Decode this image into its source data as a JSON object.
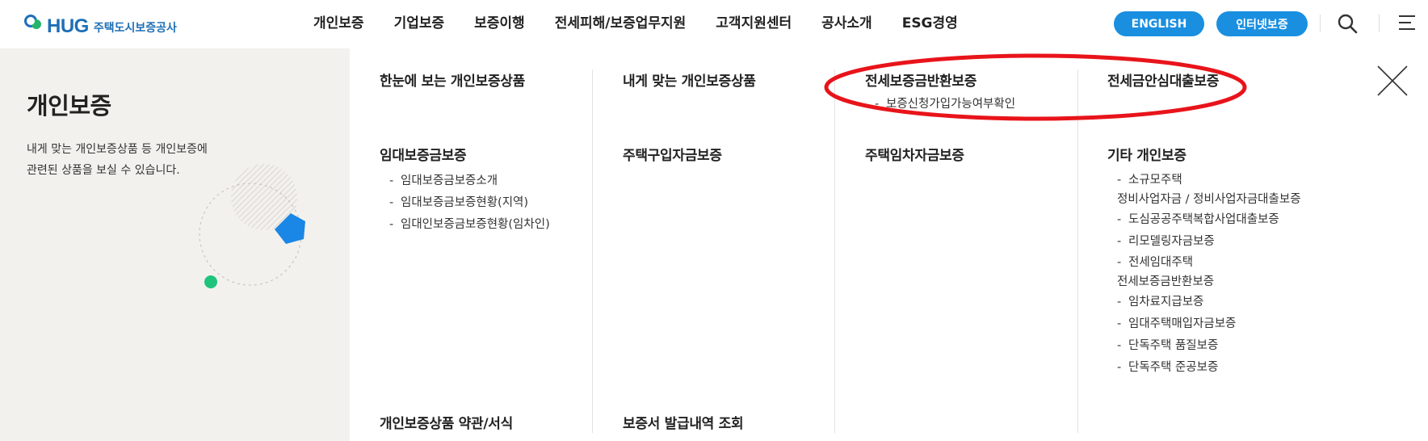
{
  "header": {
    "logo": {
      "brand": "HUG",
      "subtitle": "주택도시보증공사"
    },
    "gnb": [
      {
        "label": "개인보증"
      },
      {
        "label": "기업보증"
      },
      {
        "label": "보증이행"
      },
      {
        "label": "전세피해/보증업무지원"
      },
      {
        "label": "고객지원센터"
      },
      {
        "label": "공사소개"
      },
      {
        "label": "ESG경영"
      }
    ],
    "english_button": "ENGLISH",
    "internet_button": "인터넷보증",
    "icons": {
      "search": "search-icon",
      "menu": "menu-icon"
    },
    "accent_color": "#1a8fe0"
  },
  "panel": {
    "side": {
      "title": "개인보증",
      "desc_line1": "내게 맞는 개인보증상품 등 개인보증에",
      "desc_line2": "관련된 상품을 보실 수 있습니다."
    },
    "close_icon": "close-icon",
    "columns": [
      {
        "groups": [
          {
            "title": "한눈에 보는 개인보증상품",
            "items": []
          },
          {
            "title": "임대보증금보증",
            "items": [
              "임대보증금보증소개",
              "임대보증금보증현황(지역)",
              "임대인보증금보증현황(임차인)"
            ]
          },
          {
            "title": "개인보증상품 약관/서식",
            "items": []
          }
        ]
      },
      {
        "groups": [
          {
            "title": "내게 맞는 개인보증상품",
            "items": []
          },
          {
            "title": "주택구입자금보증",
            "items": []
          },
          {
            "title": "보증서 발급내역 조회",
            "items": []
          }
        ]
      },
      {
        "groups": [
          {
            "title": "전세보증금반환보증",
            "items": [
              "보증신청가입가능여부확인"
            ]
          },
          {
            "title": "주택임차자금보증",
            "items": []
          }
        ]
      },
      {
        "groups": [
          {
            "title": "전세금안심대출보증",
            "items": []
          },
          {
            "title": "기타 개인보증",
            "items": [
              "소규모주택",
              "정비사업자금 / 정비사업자금대출보증",
              "도심공공주택복합사업대출보증",
              "리모델링자금보증",
              "전세임대주택",
              "전세보증금반환보증",
              "임차료지급보증",
              "임대주택매입자금보증",
              "단독주택 품질보증",
              "단독주택 준공보증"
            ]
          }
        ]
      }
    ],
    "annotation_color": "#e8141a"
  }
}
